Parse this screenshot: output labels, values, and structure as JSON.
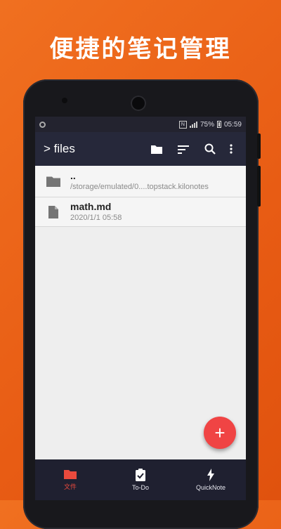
{
  "promo": {
    "headline": "便捷的笔记管理"
  },
  "status_bar": {
    "battery": "75%",
    "time": "05:59"
  },
  "app_bar": {
    "title": "> files",
    "actions": [
      "folder-icon",
      "sort-icon",
      "search-icon",
      "more-vert-icon"
    ]
  },
  "files": [
    {
      "name": "..",
      "meta": "/storage/emulated/0....topstack.kilonotes",
      "icon": "folder-icon"
    },
    {
      "name": "math.md",
      "meta": "2020/1/1 05:58",
      "icon": "file-icon"
    }
  ],
  "fab": {
    "icon": "add-icon",
    "symbol": "+"
  },
  "bottom_nav": {
    "tabs": [
      {
        "label": "文件",
        "icon": "folder-icon",
        "active": true
      },
      {
        "label": "To-Do",
        "icon": "clipboard-check-icon",
        "active": false
      },
      {
        "label": "QuickNote",
        "icon": "lightning-icon",
        "active": false
      }
    ]
  },
  "colors": {
    "background": "#e85c14",
    "app_bar": "#26283a",
    "accent": "#f04444",
    "active_tab": "#e94a3d"
  }
}
